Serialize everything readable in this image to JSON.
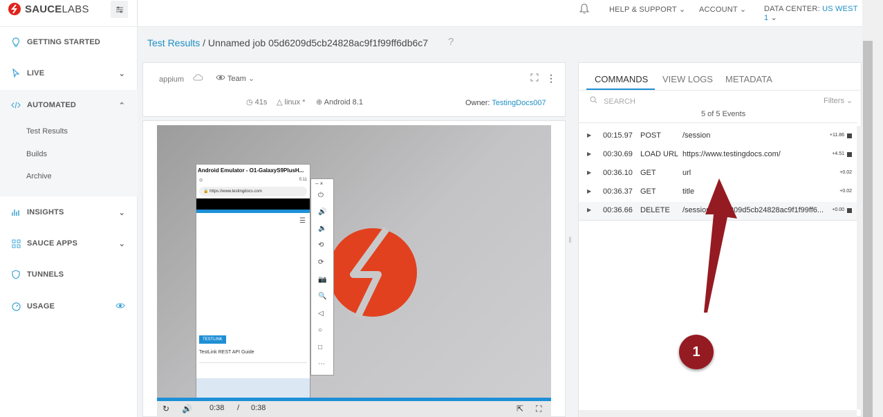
{
  "brand": {
    "name_bold": "SAUCE",
    "name_light": "LABS"
  },
  "topbar": {
    "help": "HELP & SUPPORT",
    "account": "ACCOUNT",
    "data_center_label": "DATA CENTER:",
    "data_center_value": "US WEST 1"
  },
  "sidebar": {
    "items": [
      {
        "label": "GETTING STARTED",
        "icon": "lightbulb-icon"
      },
      {
        "label": "LIVE",
        "icon": "cursor-icon"
      },
      {
        "label": "AUTOMATED",
        "icon": "code-icon"
      },
      {
        "label": "INSIGHTS",
        "icon": "bar-chart-icon"
      },
      {
        "label": "SAUCE APPS",
        "icon": "apps-grid-icon"
      },
      {
        "label": "TUNNELS",
        "icon": "shield-icon"
      },
      {
        "label": "USAGE",
        "icon": "gauge-icon"
      }
    ],
    "sub_items": [
      "Test Results",
      "Builds",
      "Archive"
    ]
  },
  "header": {
    "breadcrumb_link": "Test Results",
    "separator": "/",
    "job_title": "Unnamed job 05d6209d5cb24828ac9f1f99ff6db6c7"
  },
  "info": {
    "framework": "appium",
    "visibility": "Team",
    "duration": "41s",
    "os": "linux *",
    "platform": "Android 8.1",
    "owner_label": "Owner:",
    "owner": "TestingDocs007"
  },
  "emulator": {
    "title": "Android Emulator - O1-GalaxyS9PlusH...",
    "url": "https://www.testingdocs.com",
    "status_time": "5:11",
    "tag": "TESTLINK",
    "article": "TestLink REST API Guide"
  },
  "video": {
    "current_time": "0:38",
    "separator": "/",
    "total_time": "0:38",
    "progress": 1.0
  },
  "right": {
    "tabs": [
      "COMMANDS",
      "VIEW LOGS",
      "METADATA"
    ],
    "search_placeholder": "SEARCH",
    "filters": "Filters",
    "events_count": "5 of 5 Events",
    "rows": [
      {
        "time": "00:15.97",
        "method": "POST",
        "path": "/session",
        "delta": "+11.86",
        "screenshot": true
      },
      {
        "time": "00:30.69",
        "method": "LOAD URL",
        "path": "https://www.testingdocs.com/",
        "delta": "+4.51",
        "screenshot": true
      },
      {
        "time": "00:36.10",
        "method": "GET",
        "path": "url",
        "delta": "+0.02",
        "screenshot": false
      },
      {
        "time": "00:36.37",
        "method": "GET",
        "path": "title",
        "delta": "+0.02",
        "screenshot": false
      },
      {
        "time": "00:36.66",
        "method": "DELETE",
        "path": "/session/05d6209d5cb24828ac9f1f99ff6...",
        "delta": "+0.00",
        "screenshot": true
      }
    ]
  },
  "annotation": {
    "number": "1",
    "color": "#951b22"
  }
}
